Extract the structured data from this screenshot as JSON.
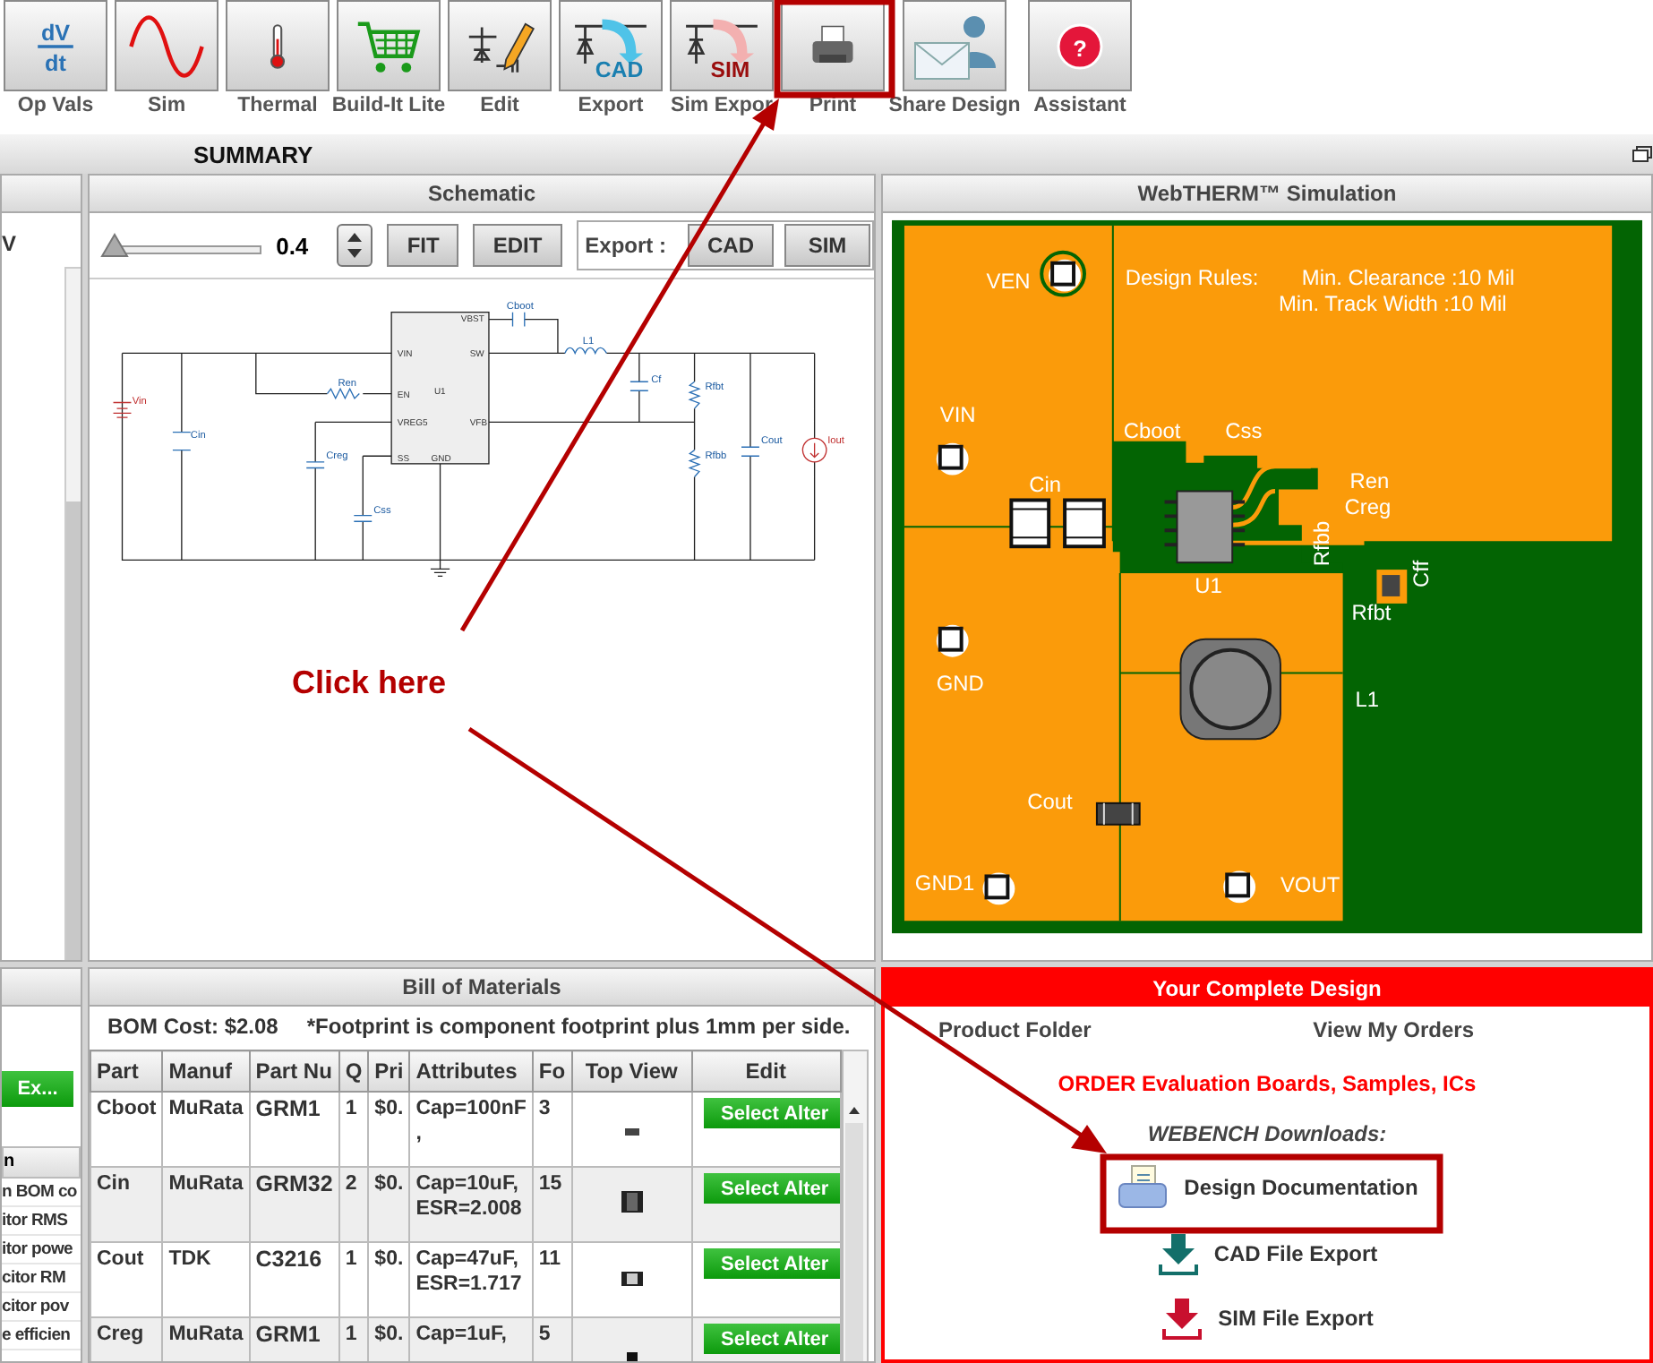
{
  "toolbar": {
    "tools": [
      {
        "label": "Op Vals",
        "icon_text": [
          "dV",
          "dt"
        ]
      },
      {
        "label": "Sim"
      },
      {
        "label": "Thermal"
      },
      {
        "label": "Build-It Lite"
      },
      {
        "label": "Edit"
      },
      {
        "label": "Export",
        "icon_text": [
          "CAD"
        ]
      },
      {
        "label": "Sim Expor",
        "icon_text": [
          "SIM"
        ]
      },
      {
        "label": "Print"
      },
      {
        "label": "Share Design"
      },
      {
        "label": "Assistant",
        "icon_text": [
          "?"
        ]
      }
    ]
  },
  "summary_bar": {
    "title": "SUMMARY"
  },
  "left_panel": {
    "value": "V"
  },
  "left_lower": {
    "button": "Ex...",
    "column": "n",
    "rows": [
      "n BOM co",
      "itor RMS",
      "itor powe",
      "citor RM",
      "citor pov",
      "e efficien"
    ]
  },
  "schematic": {
    "title": "Schematic",
    "zoom": {
      "level": 0,
      "reading": "0.4"
    },
    "buttons": [
      "FIT",
      "EDIT"
    ],
    "export_label": "Export :",
    "export_buttons": [
      "CAD",
      "SIM"
    ],
    "labels": [
      "VIN",
      "EN",
      "VREG5",
      "SS",
      "GND",
      "VBST",
      "SW",
      "VFB",
      "U1",
      "Cboot",
      "L1",
      "Ren",
      "Cin",
      "Creg",
      "Css",
      "Cf",
      "Rfbt",
      "Rfbb",
      "Cout",
      "Iout",
      "Vin"
    ]
  },
  "simulation": {
    "title": "WebTHERM™ Simulation",
    "design_rules": "Design Rules:",
    "rules": [
      "Min. Clearance :10 Mil",
      "Min. Track Width :10 Mil"
    ],
    "labels": [
      "VEN",
      "VIN",
      "Cboot",
      "Css",
      "Ren",
      "Creg",
      "Cin",
      "Rfbb",
      "Cff",
      "Rfbt",
      "U1",
      "GND",
      "L1",
      "Cout",
      "GND1",
      "VOUT"
    ]
  },
  "bom": {
    "title": "Bill of Materials",
    "cost": "BOM Cost: $2.08",
    "note": "*Footprint is component footprint plus 1mm per side.",
    "columns": [
      "Part",
      "Manuf",
      "Part Nu",
      "Q",
      "Pri",
      "Attributes",
      "Fo",
      "Top View",
      "Edit"
    ],
    "rows": [
      {
        "part": "Cboot",
        "manufacturer": "MuRata",
        "part_number": "GRM1",
        "qty": "1",
        "price": "$0.",
        "attributes": [
          "Cap=100nF",
          ","
        ],
        "footprint": "3",
        "button": "Select Alter"
      },
      {
        "part": "Cin",
        "manufacturer": "MuRata",
        "part_number": "GRM32",
        "qty": "2",
        "price": "$0.",
        "attributes": [
          "Cap=10uF,",
          "ESR=2.008"
        ],
        "footprint": "15",
        "button": "Select Alter"
      },
      {
        "part": "Cout",
        "manufacturer": "TDK",
        "part_number": "C3216",
        "qty": "1",
        "price": "$0.",
        "attributes": [
          "Cap=47uF,",
          "ESR=1.717"
        ],
        "footprint": "11",
        "button": "Select Alter"
      },
      {
        "part": "Creg",
        "manufacturer": "MuRata",
        "part_number": "GRM1",
        "qty": "1",
        "price": "$0.",
        "attributes": [
          "Cap=1uF,"
        ],
        "footprint": "5",
        "button": "Select Alter"
      }
    ]
  },
  "design": {
    "title": "Your Complete Design",
    "links": [
      "Product Folder",
      "View My Orders"
    ],
    "order": "ORDER Evaluation Boards, Samples, ICs",
    "downloads_title": "WEBENCH Downloads:",
    "downloads": [
      "Design Documentation",
      "CAD File Export",
      "SIM File Export"
    ]
  },
  "annotation": {
    "text": "Click here"
  }
}
